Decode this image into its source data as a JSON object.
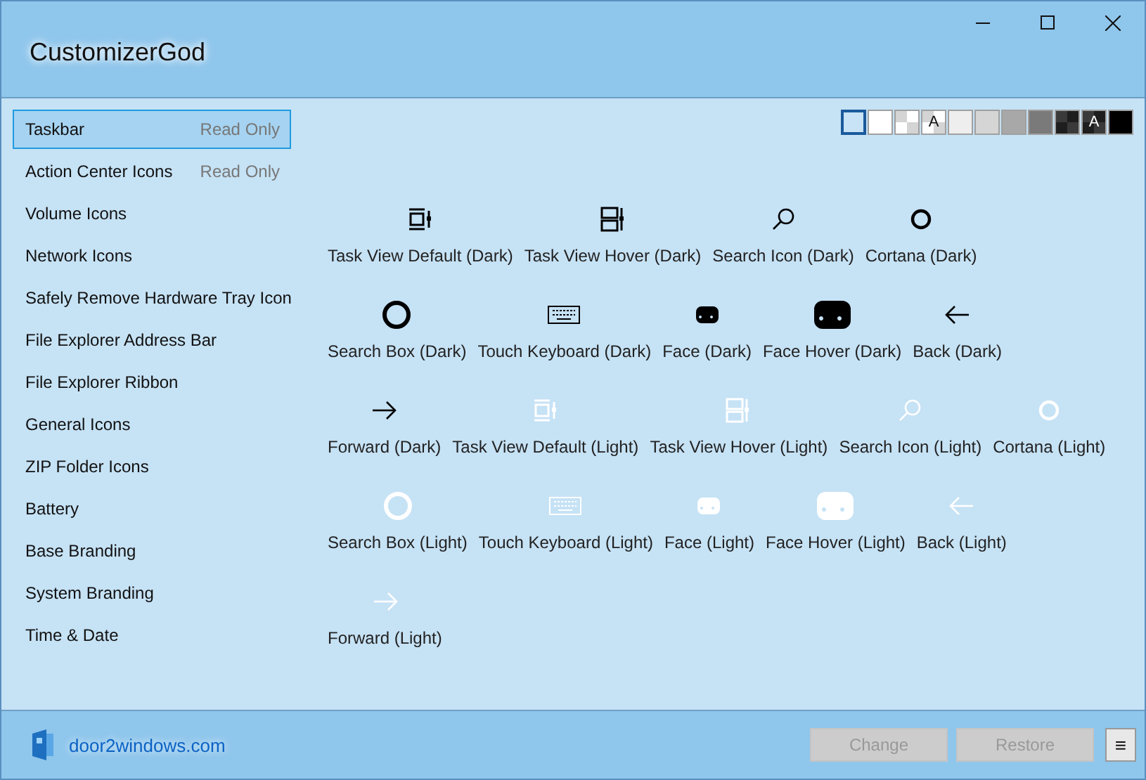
{
  "window": {
    "title": "CustomizerGod",
    "controls": [
      {
        "kind": "minimize"
      },
      {
        "kind": "maximize"
      },
      {
        "kind": "close"
      }
    ]
  },
  "sidebar": {
    "items": [
      {
        "label": "Taskbar",
        "badge": "Read Only",
        "selected": true
      },
      {
        "label": "Action Center Icons",
        "badge": "Read Only",
        "selected": false
      },
      {
        "label": "Volume Icons",
        "selected": false
      },
      {
        "label": "Network Icons",
        "selected": false
      },
      {
        "label": "Safely Remove Hardware Tray Icon",
        "selected": false
      },
      {
        "label": "File Explorer Address Bar",
        "selected": false
      },
      {
        "label": "File Explorer Ribbon",
        "selected": false
      },
      {
        "label": "General Icons",
        "selected": false
      },
      {
        "label": "ZIP Folder Icons",
        "selected": false
      },
      {
        "label": "Battery",
        "selected": false
      },
      {
        "label": "Base Branding",
        "selected": false
      },
      {
        "label": "System Branding",
        "selected": false
      },
      {
        "label": "Time & Date",
        "selected": false
      }
    ]
  },
  "backgrounds": [
    {
      "kind": "solid",
      "color": "#c8e3f6",
      "selected": true
    },
    {
      "kind": "solid",
      "color": "#ffffff",
      "selected": false
    },
    {
      "kind": "checker",
      "color": "#d4d4d4",
      "selected": false
    },
    {
      "kind": "letter",
      "color": "#d4d4d4",
      "label": "A",
      "selected": false
    },
    {
      "kind": "solid",
      "color": "#eeeeee",
      "selected": false
    },
    {
      "kind": "solid",
      "color": "#d5d5d5",
      "selected": false
    },
    {
      "kind": "solid",
      "color": "#a8a8a8",
      "selected": false
    },
    {
      "kind": "solid",
      "color": "#7a7a7a",
      "selected": false
    },
    {
      "kind": "checker",
      "color": "#3a3a3a",
      "selected": false
    },
    {
      "kind": "letter",
      "color": "#3a3a3a",
      "label": "A",
      "selected": false
    },
    {
      "kind": "solid",
      "color": "#000000",
      "selected": false
    }
  ],
  "icon_rows": [
    [
      {
        "kind": "task-view-default",
        "light": false,
        "label": "Task View Default (Dark)"
      },
      {
        "kind": "task-view-hover",
        "light": false,
        "label": "Task View Hover (Dark)"
      },
      {
        "kind": "search",
        "light": false,
        "label": "Search Icon (Dark)"
      },
      {
        "kind": "cortana",
        "light": false,
        "label": "Cortana (Dark)"
      }
    ],
    [
      {
        "kind": "search-box",
        "light": false,
        "label": "Search Box (Dark)"
      },
      {
        "kind": "keyboard",
        "light": false,
        "label": "Touch Keyboard (Dark)"
      },
      {
        "kind": "face",
        "light": false,
        "label": "Face (Dark)"
      },
      {
        "kind": "face-hover",
        "light": false,
        "label": "Face Hover (Dark)"
      },
      {
        "kind": "back",
        "light": false,
        "label": "Back (Dark)"
      }
    ],
    [
      {
        "kind": "forward",
        "light": false,
        "label": "Forward (Dark)"
      },
      {
        "kind": "task-view-default",
        "light": true,
        "label": "Task View Default (Light)"
      },
      {
        "kind": "task-view-hover",
        "light": true,
        "label": "Task View Hover (Light)"
      },
      {
        "kind": "search",
        "light": true,
        "label": "Search Icon (Light)"
      },
      {
        "kind": "cortana",
        "light": true,
        "label": "Cortana (Light)"
      }
    ],
    [
      {
        "kind": "search-box",
        "light": true,
        "label": "Search Box (Light)"
      },
      {
        "kind": "keyboard",
        "light": true,
        "label": "Touch Keyboard (Light)"
      },
      {
        "kind": "face",
        "light": true,
        "label": "Face (Light)"
      },
      {
        "kind": "face-hover",
        "light": true,
        "label": "Face Hover (Light)"
      },
      {
        "kind": "back",
        "light": true,
        "label": "Back (Light)"
      }
    ],
    [
      {
        "kind": "forward",
        "light": true,
        "label": "Forward (Light)"
      }
    ]
  ],
  "footer": {
    "link": "door2windows.com",
    "buttons": [
      {
        "label": "Change",
        "disabled": true
      },
      {
        "label": "Restore",
        "disabled": true
      }
    ],
    "menu": "≡"
  }
}
